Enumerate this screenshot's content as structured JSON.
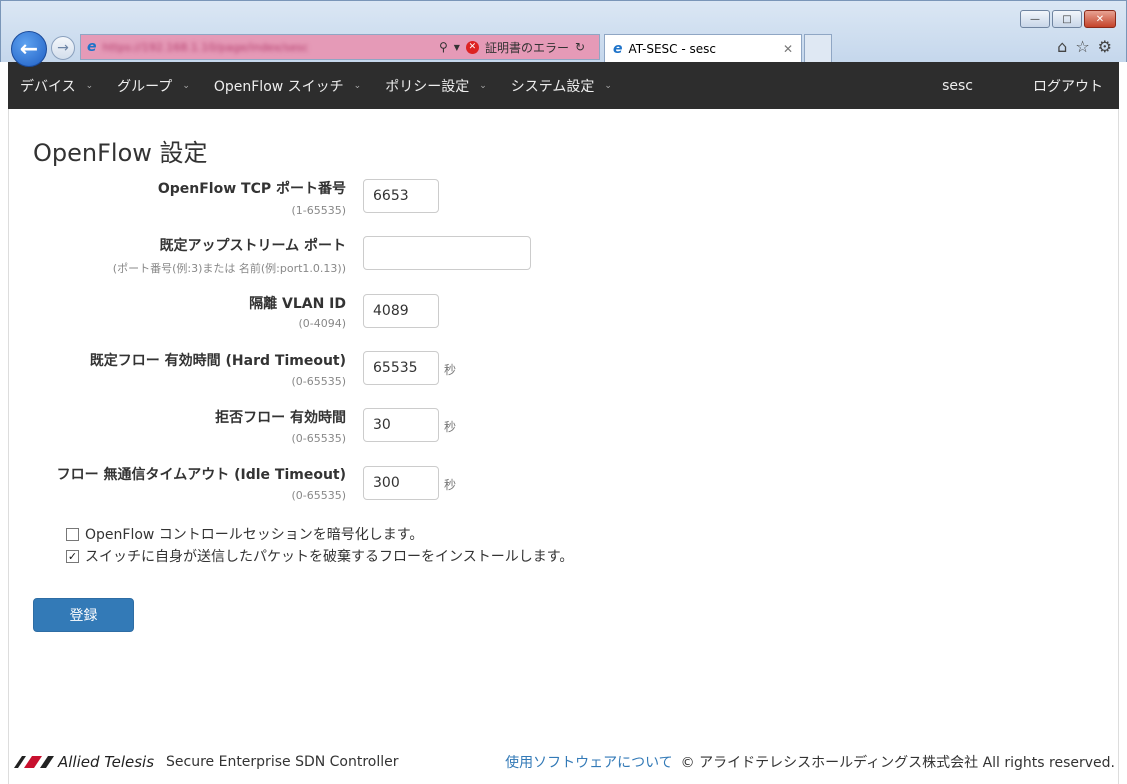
{
  "browser": {
    "address_url": "https://192.168.1.10/page/index/sesc",
    "cert_error": "証明書のエラー",
    "tab_title": "AT-SESC - sesc"
  },
  "nav": {
    "items": [
      {
        "label": "デバイス"
      },
      {
        "label": "グループ"
      },
      {
        "label": "OpenFlow スイッチ"
      },
      {
        "label": "ポリシー設定"
      },
      {
        "label": "システム設定"
      }
    ],
    "user": "sesc",
    "logout": "ログアウト"
  },
  "page": {
    "title": "OpenFlow 設定"
  },
  "form": {
    "fields": [
      {
        "label": "OpenFlow TCP ポート番号",
        "hint": "(1-65535)",
        "value": "6653",
        "unit": ""
      },
      {
        "label": "既定アップストリーム ポート",
        "hint": "(ポート番号(例:3)または 名前(例:port1.0.13))",
        "value": "",
        "unit": ""
      },
      {
        "label": "隔離 VLAN ID",
        "hint": "(0-4094)",
        "value": "4089",
        "unit": ""
      },
      {
        "label": "既定フロー 有効時間 (Hard Timeout)",
        "hint": "(0-65535)",
        "value": "65535",
        "unit": "秒"
      },
      {
        "label": "拒否フロー 有効時間",
        "hint": "(0-65535)",
        "value": "30",
        "unit": "秒"
      },
      {
        "label": "フロー 無通信タイムアウト (Idle Timeout)",
        "hint": "(0-65535)",
        "value": "300",
        "unit": "秒"
      }
    ],
    "checkboxes": [
      {
        "label": "OpenFlow コントロールセッションを暗号化します。",
        "checked": false
      },
      {
        "label": "スイッチに自身が送信したパケットを破棄するフローをインストールします。",
        "checked": true
      }
    ],
    "submit": "登録"
  },
  "footer": {
    "brand": "Allied Telesis",
    "product": "Secure Enterprise SDN Controller",
    "software_link": "使用ソフトウェアについて",
    "copyright": "© アライドテレシスホールディングス株式会社 All rights reserved."
  }
}
